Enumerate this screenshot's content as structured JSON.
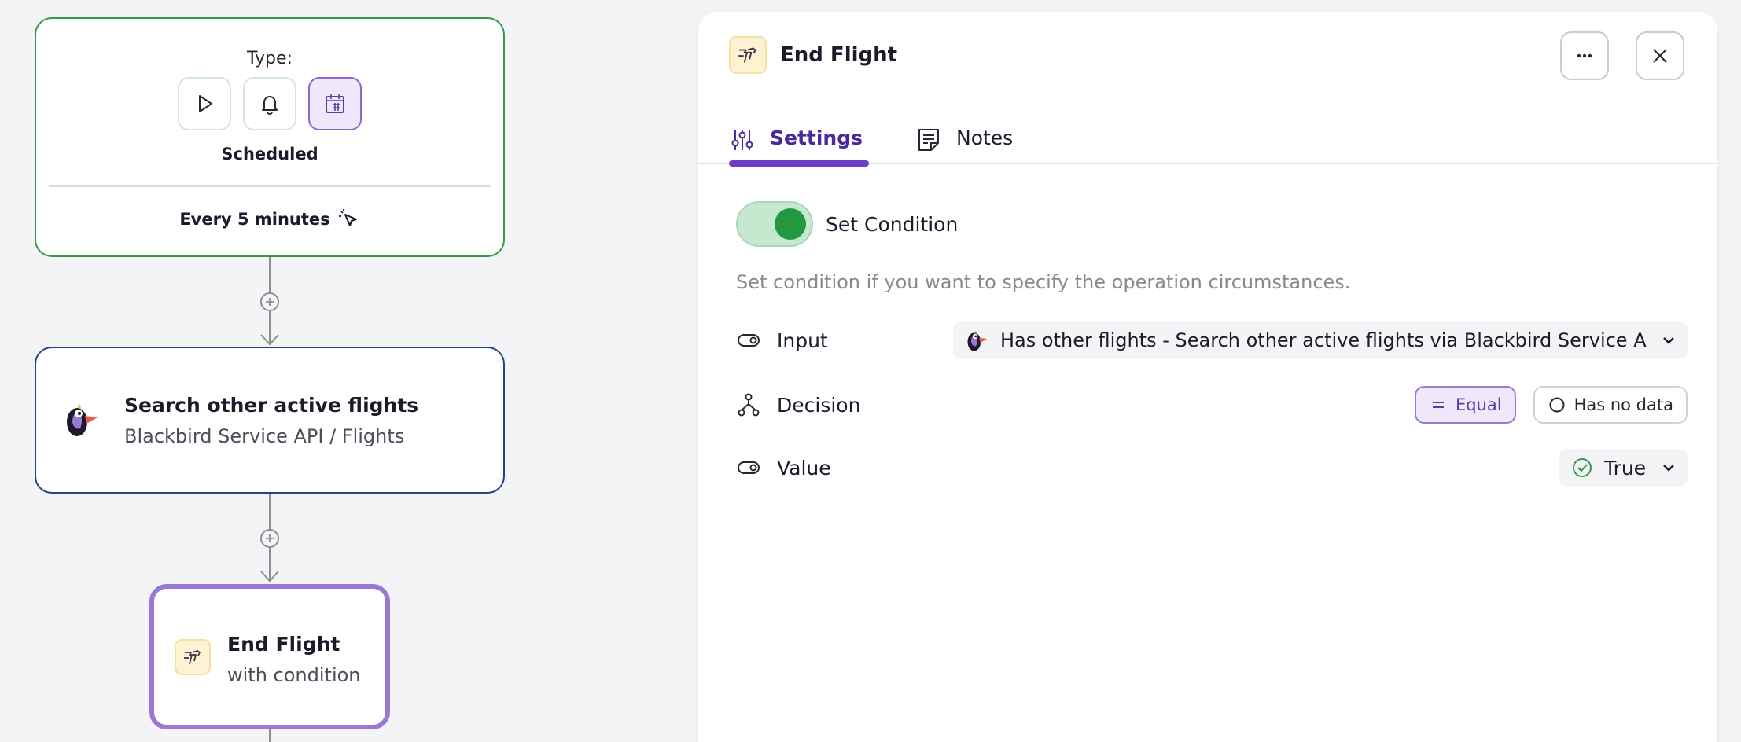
{
  "flow": {
    "trigger": {
      "type_label": "Type:",
      "types": [
        "play-icon",
        "bell-icon",
        "calendar-icon"
      ],
      "selected_type": "Scheduled",
      "schedule": "Every 5 minutes"
    },
    "action": {
      "title": "Search other active flights",
      "subtitle": "Blackbird Service API / Flights"
    },
    "end": {
      "title": "End Flight",
      "subtitle": "with condition"
    }
  },
  "panel": {
    "title": "End Flight",
    "tabs": [
      {
        "label": "Settings",
        "active": true
      },
      {
        "label": "Notes",
        "active": false
      }
    ],
    "toggle": {
      "label": "Set Condition",
      "on": true
    },
    "help": "Set condition if you want to specify the operation circumstances.",
    "fields": {
      "input": {
        "label": "Input",
        "value": "Has other flights - Search other active flights via Blackbird Service API"
      },
      "decision": {
        "label": "Decision",
        "options": [
          {
            "label": "Equal",
            "selected": true
          },
          {
            "label": "Has no data",
            "selected": false
          }
        ]
      },
      "value": {
        "label": "Value",
        "value": "True"
      }
    }
  },
  "colors": {
    "accent": "#6a3fc4",
    "trigger_border": "#2f9a4a",
    "action_border": "#24418f",
    "toggle_on": "#23993f"
  }
}
